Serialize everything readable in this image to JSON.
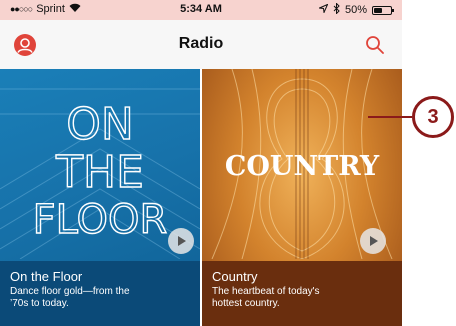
{
  "status_bar": {
    "signal": "●●○○○",
    "carrier": "Sprint",
    "time": "5:34 AM",
    "battery": "50%",
    "battery_level": 0.5
  },
  "nav": {
    "title": "Radio",
    "profile_icon": "person-circle-icon",
    "search_icon": "search-icon"
  },
  "colors": {
    "accent": "#e0443a",
    "strip_left": "#c8342c",
    "strip_right": "#4a5fc2",
    "callout": "#8b1a1a"
  },
  "stations": [
    {
      "title": "On the Floor",
      "art_text": [
        "ON",
        "THE",
        "FLOOR"
      ],
      "desc_line1": "Dance floor gold—from the",
      "desc_line2": "’70s to today."
    },
    {
      "title": "Country",
      "art_text": "COUNTRY",
      "desc_line1": "The heartbeat of today's",
      "desc_line2": "hottest country."
    }
  ],
  "callout": {
    "number": "3"
  }
}
